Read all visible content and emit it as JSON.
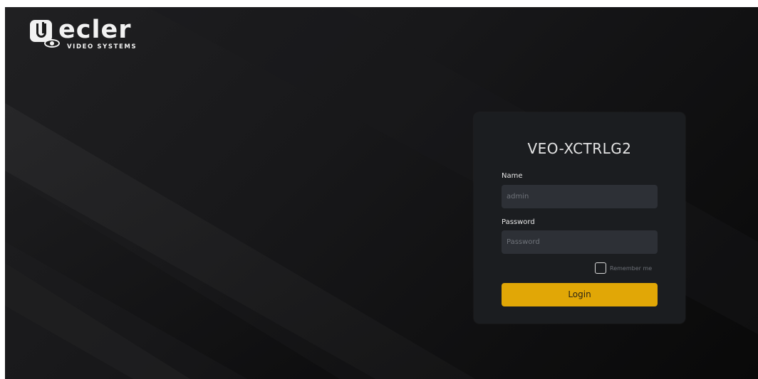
{
  "brand": {
    "wordmark": "ecler",
    "tagline": "VIDEO SYSTEMS"
  },
  "login": {
    "title": "VEO-XCTRLG2",
    "name_label": "Name",
    "name_placeholder": "admin",
    "password_label": "Password",
    "password_placeholder": "Password",
    "remember_label": "Remember me",
    "remember_checked": false,
    "button_label": "Login"
  },
  "colors": {
    "accent": "#e1a706",
    "card_bg": "#1b1d20",
    "input_bg": "#2d3036"
  }
}
